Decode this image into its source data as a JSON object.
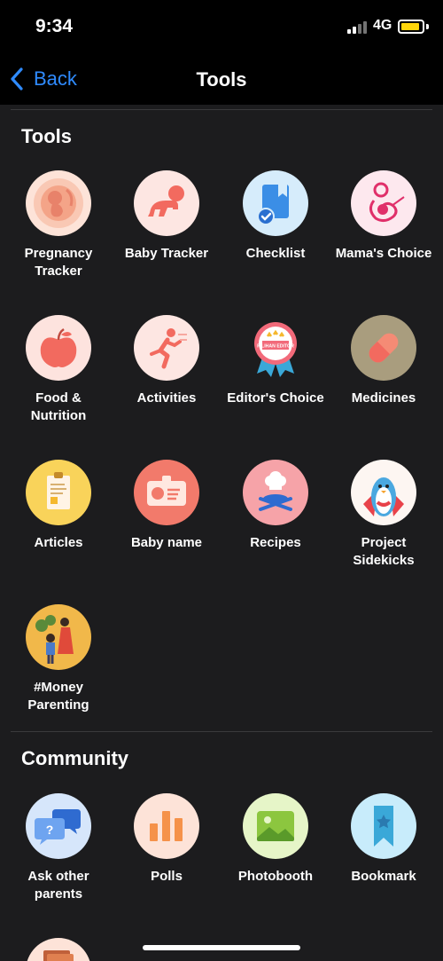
{
  "status_bar": {
    "time": "9:34",
    "network": "4G"
  },
  "nav": {
    "back_label": "Back",
    "title": "Tools"
  },
  "tools_section": {
    "title": "Tools",
    "items": [
      {
        "label": "Pregnancy Tracker",
        "icon": "fetus-icon"
      },
      {
        "label": "Baby Tracker",
        "icon": "crawling-baby-icon"
      },
      {
        "label": "Checklist",
        "icon": "checklist-icon"
      },
      {
        "label": "Mama's Choice",
        "icon": "mother-child-icon"
      },
      {
        "label": "Food & Nutrition",
        "icon": "apple-icon"
      },
      {
        "label": "Activities",
        "icon": "running-person-icon"
      },
      {
        "label": "Editor's Choice",
        "icon": "award-badge-icon",
        "badge_text": "PILIHAN EDITOR"
      },
      {
        "label": "Medicines",
        "icon": "pill-icon"
      },
      {
        "label": "Articles",
        "icon": "clipboard-icon"
      },
      {
        "label": "Baby name",
        "icon": "baby-id-card-icon"
      },
      {
        "label": "Recipes",
        "icon": "chef-utensils-icon"
      },
      {
        "label": "Project Sidekicks",
        "icon": "penguin-hero-icon"
      },
      {
        "label": "#Money Parenting",
        "icon": "family-coins-icon"
      }
    ]
  },
  "community_section": {
    "title": "Community",
    "items": [
      {
        "label": "Ask other parents",
        "icon": "chat-bubbles-icon"
      },
      {
        "label": "Polls",
        "icon": "bar-chart-icon"
      },
      {
        "label": "Photobooth",
        "icon": "photo-icon"
      },
      {
        "label": "Bookmark",
        "icon": "bookmark-icon"
      }
    ]
  },
  "colors": {
    "background": "#1c1c1e",
    "bar_background": "#000000",
    "accent_blue": "#2f8bff",
    "battery_yellow": "#ffd60a"
  }
}
